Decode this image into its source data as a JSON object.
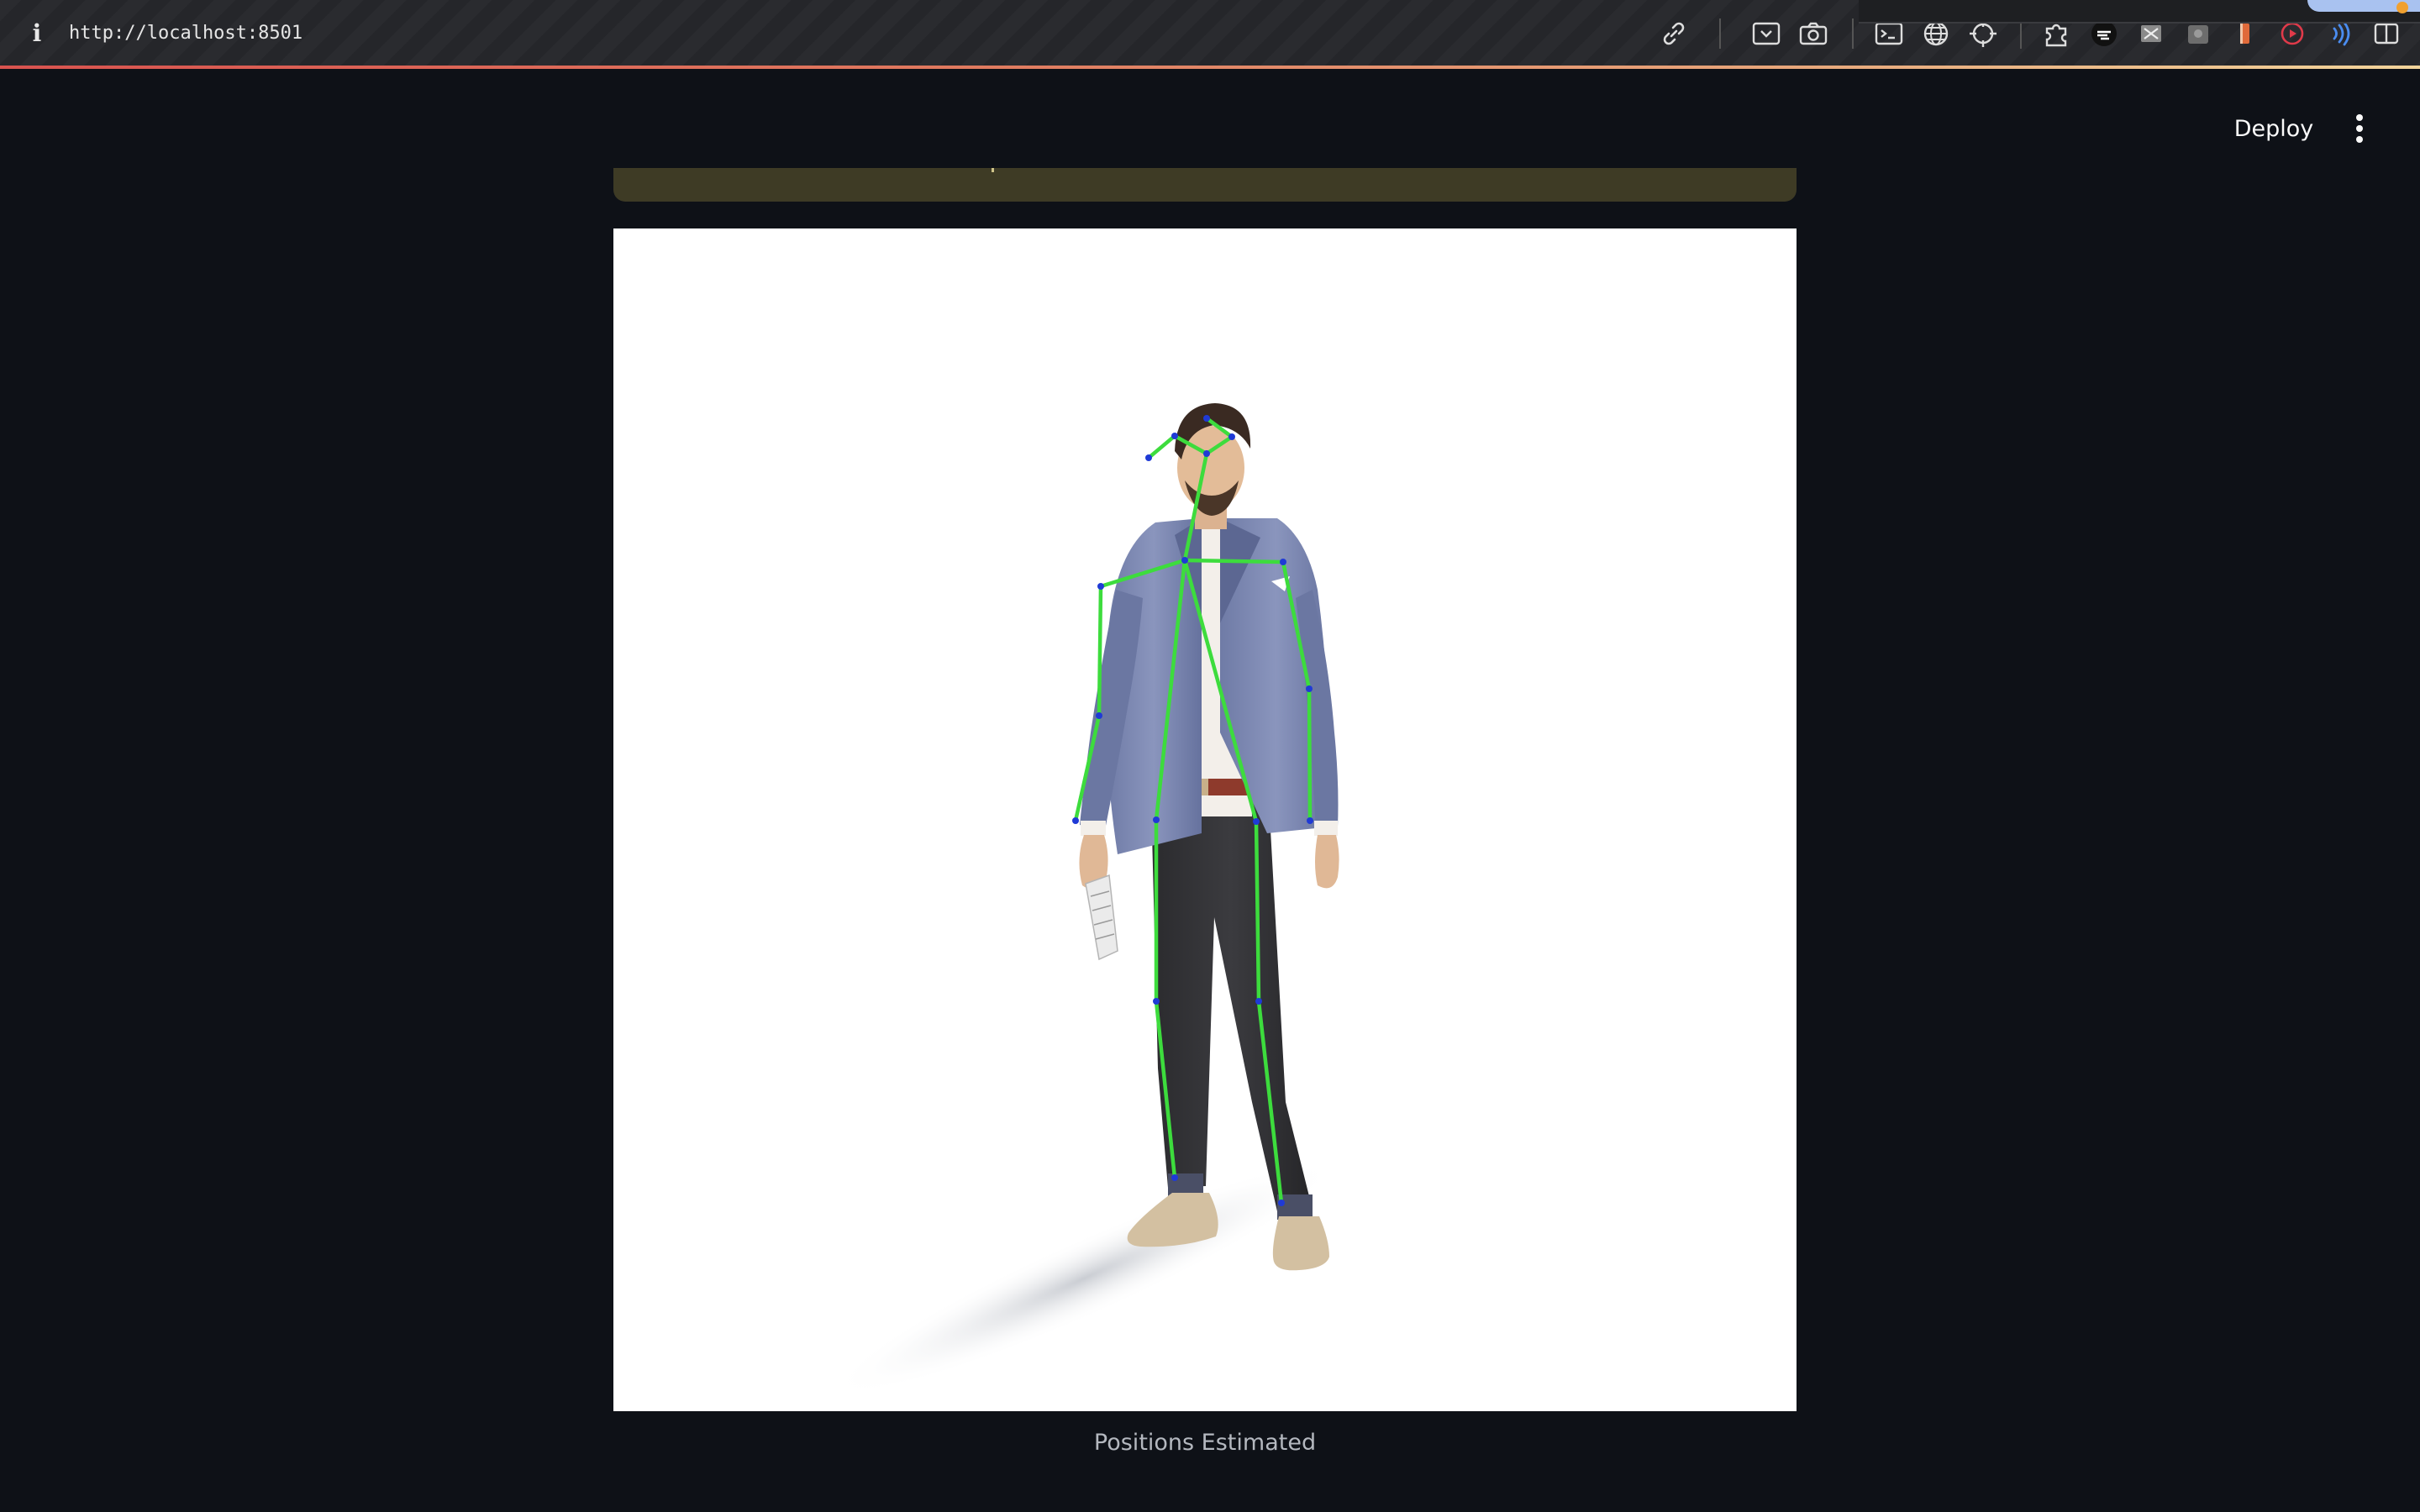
{
  "browser": {
    "url": "http://localhost:8501",
    "toolbar_icons": [
      "link-icon",
      "screen-capture-icon",
      "camera-icon",
      "terminal-icon",
      "globe-icon",
      "crosshair-icon",
      "puzzle-icon",
      "extension-icon",
      "extension-icon",
      "extension-icon",
      "extension-icon",
      "record-icon",
      "audio-wave-icon",
      "sidebar-icon"
    ]
  },
  "app": {
    "deploy_label": "Deploy",
    "menu_icon": "kebab-menu-icon"
  },
  "main": {
    "alert": {
      "color": "#3e3b25",
      "text": ""
    },
    "image": {
      "description_icon": "pose-estimation-result",
      "skeleton_color": "#3ddc3d",
      "keypoint_color": "#1f3ad6"
    },
    "caption": "Positions Estimated"
  },
  "colors": {
    "background": "#0e1117",
    "toolbar": "#2a2b2f",
    "text": "#fafafa",
    "caption": "#b4b8bf"
  }
}
